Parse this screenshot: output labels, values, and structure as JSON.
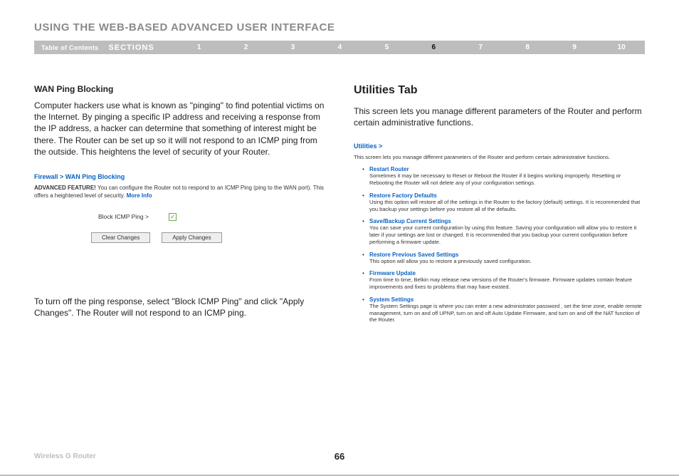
{
  "header": {
    "title": "USING THE WEB-BASED ADVANCED USER INTERFACE"
  },
  "nav": {
    "toc": "Table of Contents",
    "sections_label": "SECTIONS",
    "numbers": [
      "1",
      "2",
      "3",
      "4",
      "5",
      "6",
      "7",
      "8",
      "9",
      "10"
    ],
    "active_index": 5
  },
  "left": {
    "heading": "WAN Ping Blocking",
    "paragraph": "Computer hackers use what is known as \"pinging\" to find potential victims on the Internet. By pinging a specific IP address and receiving a response from the IP address, a hacker can determine that something of interest might be there. The Router can be set up so it will not respond to an ICMP ping from the outside. This heightens the level of security of your Router.",
    "breadcrumb": "Firewall > WAN Ping Blocking",
    "adv_bold": "ADVANCED FEATURE!",
    "adv_text": " You can configure the Router not to respond to an ICMP Ping (ping to the WAN port). This offers a heightened level of security. ",
    "adv_more": "More Info",
    "config_label": "Block ICMP Ping >",
    "checkbox_mark": "✓",
    "btn_clear": "Clear Changes",
    "btn_apply": "Apply Changes",
    "follow": "To turn off the ping response, select \"Block ICMP Ping\" and click \"Apply Changes\". The Router will not respond to an ICMP ping."
  },
  "right": {
    "heading": "Utilities Tab",
    "intro": "This screen lets you manage different parameters of the Router and perform certain administrative functions.",
    "crumb": "Utilities >",
    "desc": "This screen lets you manage different parameters of the Router and perform certain administrative functions.",
    "items": [
      {
        "title": "Restart Router",
        "desc": "Sometimes it may be necessary to Reset or Reboot the Router if it begins working improperly. Resetting or Rebooting the Router will not delete any of your configuration settings."
      },
      {
        "title": "Restore Factory Defaults",
        "desc": "Using this option will restore all of the settings in the Router to the factory (default) settings. It is recommended that you backup your settings before you restore all of the defaults."
      },
      {
        "title": "Save/Backup Current Settings",
        "desc": "You can save your current configuration by using this feature. Saving your configuration will allow you to restore it later if your settings are lost or changed. It is recommended that you backup your current configuration before performing a firmware update."
      },
      {
        "title": "Restore Previous Saved Settings",
        "desc": "This option will allow you to restore a previously saved configuration."
      },
      {
        "title": "Firmware Update",
        "desc": "From time to time, Belkin may release new versions of the Router's firmware. Firmware updates contain feature improvements and fixes to problems that may have existed."
      },
      {
        "title": "System Settings",
        "desc": "The System Settings page is where you can enter a new administrator password , set the time zone, enable remote management, turn on and off UPNP, turn on and off Auto Update Firmware, and turn on and off the NAT function of the Router."
      }
    ]
  },
  "footer": {
    "product": "Wireless G Router",
    "page": "66"
  }
}
